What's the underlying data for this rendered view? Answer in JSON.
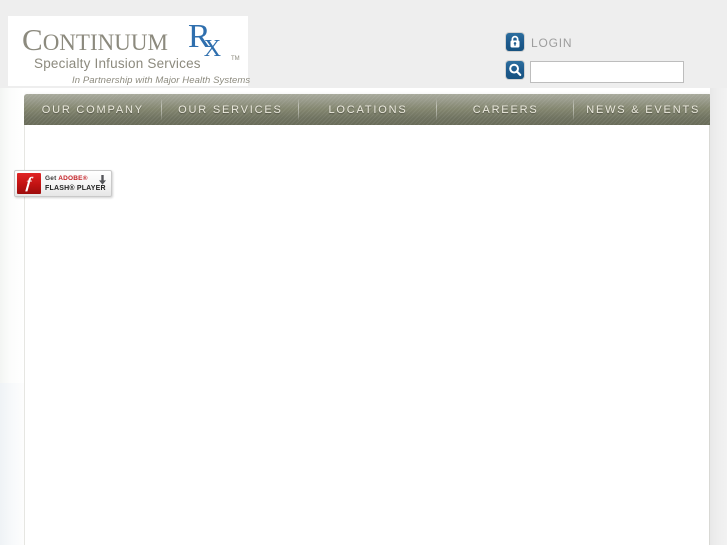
{
  "brand": {
    "logo_main_primary": "C",
    "logo_main_rest": "ONTINUUM",
    "logo_rx_r": "R",
    "logo_rx_x": "X",
    "logo_tm": "TM",
    "tagline": "Specialty Infusion Services",
    "partnership": "In Partnership with Major Health Systems",
    "color_logo_text": "#8c8a7e",
    "color_rx_blue": "#2f6fae"
  },
  "header": {
    "login_label": "LOGIN",
    "lock_icon": "lock-icon",
    "search_icon": "search-icon",
    "search_value": "",
    "search_placeholder": "",
    "icon_blue": "#1d5b8e"
  },
  "nav": {
    "items": [
      {
        "label": "OUR COMPANY"
      },
      {
        "label": "OUR SERVICES"
      },
      {
        "label": "LOCATIONS"
      },
      {
        "label": "CAREERS"
      },
      {
        "label": "NEWS & EVENTS"
      }
    ],
    "bar_color": "#83866f",
    "text_color": "#eceade"
  },
  "content": {
    "flash_badge": {
      "get_text": "Get ",
      "adobe_text": "ADOBE",
      "adobe_reg": "®",
      "line2": "FLASH® PLAYER",
      "icon": "adobe-flash-icon",
      "download_icon": "download-arrow-icon",
      "icon_color": "#c11212"
    }
  }
}
